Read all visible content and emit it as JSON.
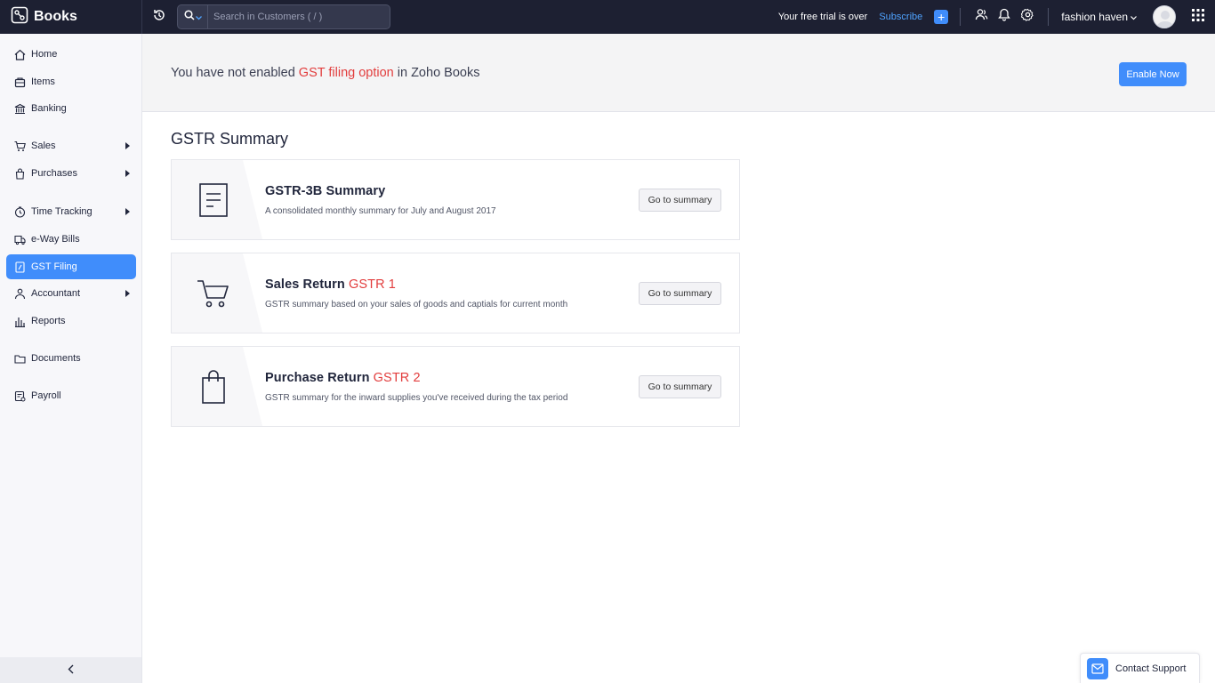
{
  "app": {
    "name": "Books"
  },
  "search": {
    "placeholder": "Search in Customers ( / )"
  },
  "header": {
    "trial_text": "Your free trial is over",
    "subscribe_label": "Subscribe",
    "org_name": "fashion haven"
  },
  "sidebar": {
    "items": [
      {
        "label": "Home",
        "icon": "home-icon"
      },
      {
        "label": "Items",
        "icon": "items-icon"
      },
      {
        "label": "Banking",
        "icon": "bank-icon"
      },
      {
        "label": "Sales",
        "icon": "cart-icon",
        "expandable": true
      },
      {
        "label": "Purchases",
        "icon": "bag-icon",
        "expandable": true
      },
      {
        "label": "Time Tracking",
        "icon": "clock-icon",
        "expandable": true
      },
      {
        "label": "e-Way Bills",
        "icon": "truck-icon"
      },
      {
        "label": "GST Filing",
        "icon": "gst-icon",
        "active": true
      },
      {
        "label": "Accountant",
        "icon": "accountant-icon",
        "expandable": true
      },
      {
        "label": "Reports",
        "icon": "reports-icon"
      },
      {
        "label": "Documents",
        "icon": "folder-icon"
      },
      {
        "label": "Payroll",
        "icon": "payroll-icon"
      }
    ]
  },
  "banner": {
    "text_before": "You have not enabled ",
    "highlight": "GST filing option",
    "text_after": " in Zoho Books",
    "button_label": "Enable Now"
  },
  "main": {
    "title": "GSTR Summary",
    "cards": [
      {
        "title": "GSTR-3B Summary",
        "tag": "",
        "description": "A consolidated monthly summary for July and August 2017",
        "button_label": "Go to summary",
        "icon": "document-icon"
      },
      {
        "title": "Sales Return ",
        "tag": "GSTR 1",
        "description": "GSTR summary based on your sales of goods and captials for current month",
        "button_label": "Go to summary",
        "icon": "shopping-cart-icon"
      },
      {
        "title": "Purchase Return ",
        "tag": "GSTR 2",
        "description": "GSTR summary for the inward supplies you've received during the tax period",
        "button_label": "Go to summary",
        "icon": "shopping-bag-icon"
      }
    ]
  },
  "contact_support": {
    "label": "Contact Support"
  },
  "colors": {
    "accent": "#408dfb",
    "highlight": "#e23d3d",
    "topbar": "#1d2032"
  }
}
